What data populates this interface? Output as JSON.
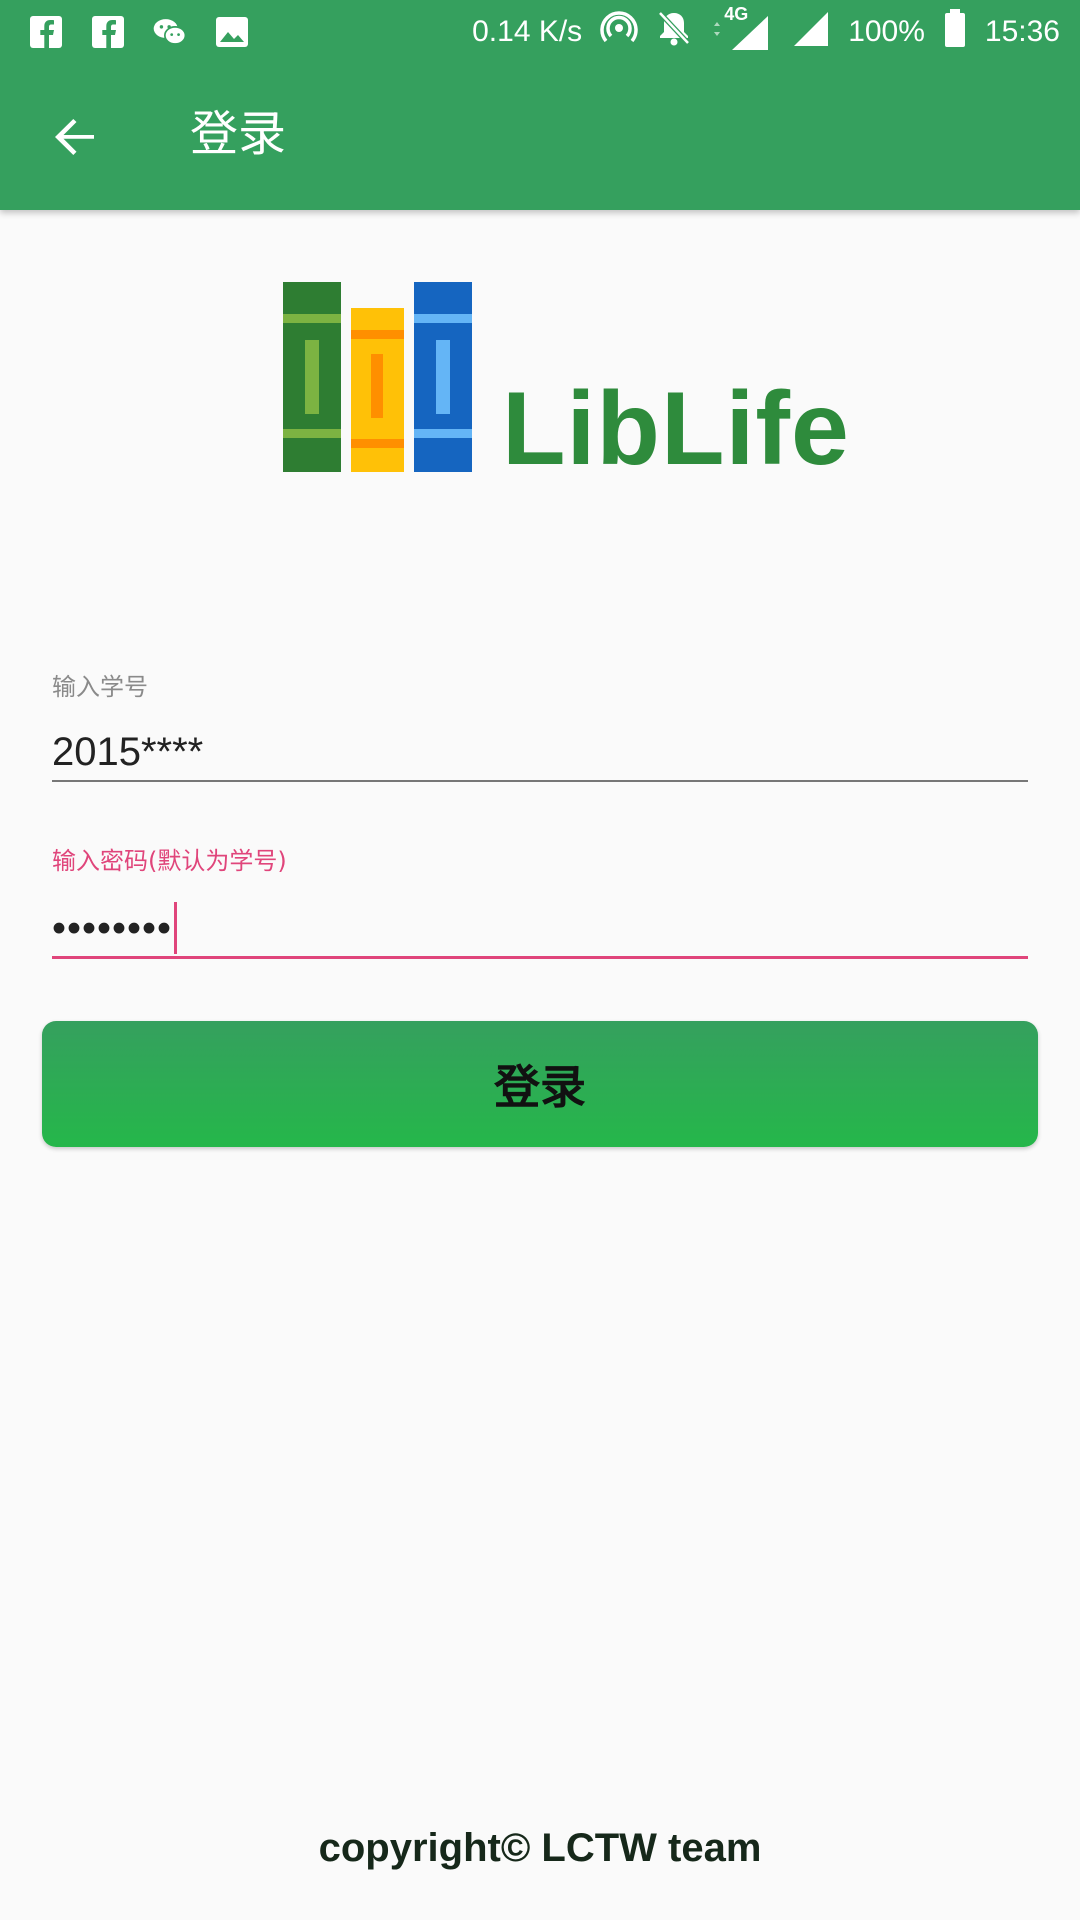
{
  "status_bar": {
    "speed": "0.14 K/s",
    "network": "4G",
    "battery": "100%",
    "time": "15:36",
    "icons": [
      "facebook-icon",
      "facebook-icon",
      "wechat-icon",
      "image-icon",
      "hotspot-icon",
      "notifications-off-icon",
      "signal-icon",
      "signal-icon",
      "battery-icon"
    ]
  },
  "app_bar": {
    "title": "登录"
  },
  "logo": {
    "text": "LibLife",
    "colors": [
      "#2e7d32",
      "#ffc107",
      "#1565c0"
    ]
  },
  "form": {
    "student_id_label": "输入学号",
    "student_id_value": "2015****",
    "password_label": "输入密码(默认为学号)",
    "password_value": "••••••••"
  },
  "login_button": "登录",
  "footer": {
    "copyright": "copyright© LCTW team"
  },
  "colors": {
    "primary": "#35a05e",
    "accent": "#e0457b"
  }
}
